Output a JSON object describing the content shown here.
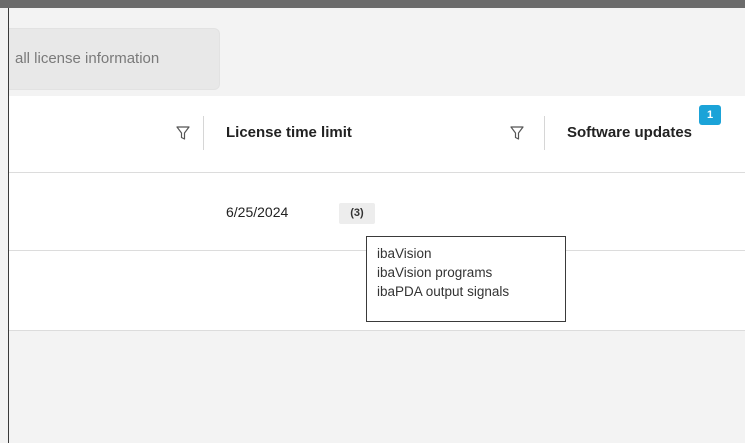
{
  "toolbar": {
    "all_license_info_label": "all license information"
  },
  "table": {
    "columns": [
      {
        "label": "License time limit"
      },
      {
        "label": "Software updates"
      }
    ],
    "rows": [
      {
        "license_time_limit": "6/25/2024",
        "limit_count": "(3)",
        "software_updates": "1"
      }
    ]
  },
  "tooltip": {
    "items": [
      "ibaVision",
      "ibaVision programs",
      "ibaPDA output signals"
    ]
  },
  "icons": {
    "filter": "filter-icon"
  },
  "colors": {
    "update_badge": "#1ba3d8",
    "top_bar": "#6b6b6b"
  }
}
